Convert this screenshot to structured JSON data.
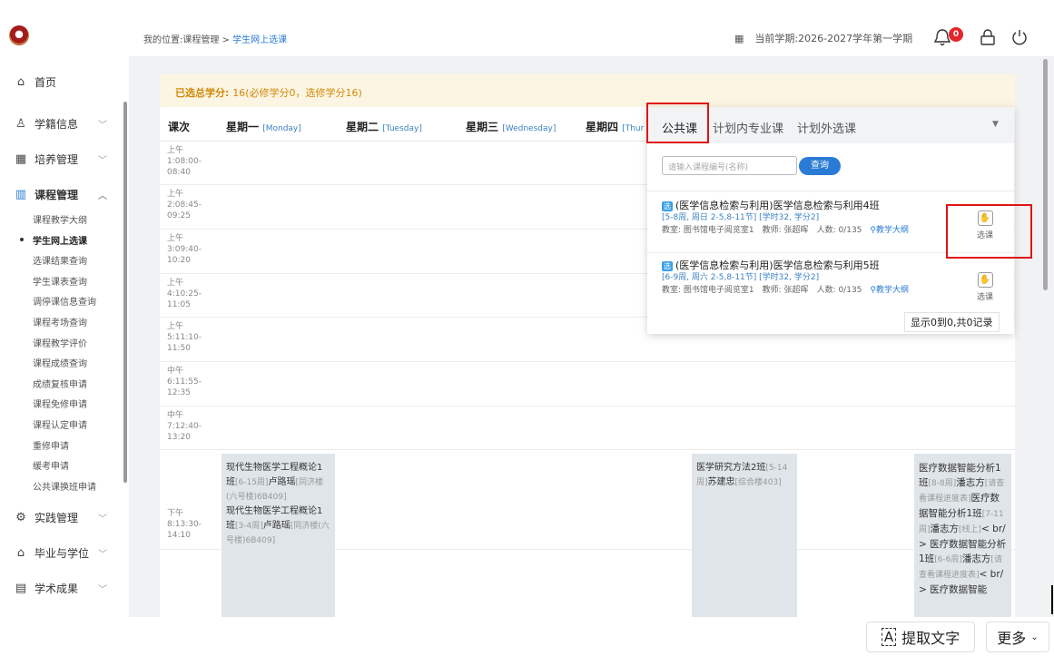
{
  "sidebar": {
    "menu": [
      {
        "label": "首页",
        "icon": "home-icon"
      },
      {
        "label": "学籍信息",
        "icon": "user-icon"
      },
      {
        "label": "培养管理",
        "icon": "chart-icon"
      },
      {
        "label": "课程管理",
        "icon": "books-icon"
      }
    ],
    "submenu": [
      "课程教学大纲",
      "学生网上选课",
      "选课结果查询",
      "学生课表查询",
      "调停课信息查询",
      "课程考场查询",
      "课程教学评价",
      "课程成绩查询",
      "成绩复核申请",
      "课程免修申请",
      "课程认定申请",
      "重修申请",
      "缓考申请",
      "公共课换班申请"
    ],
    "menu_bottom": [
      {
        "label": "实践管理",
        "icon": "settings-icon"
      },
      {
        "label": "毕业与学位",
        "icon": "graduation-icon"
      },
      {
        "label": "学术成果",
        "icon": "document-icon"
      }
    ]
  },
  "header": {
    "breadcrumb_prefix": "我的位置:课程管理 > ",
    "breadcrumb_current": "学生网上选课",
    "semester": "当前学期:2026-2027学年第一学期",
    "notification_count": "0"
  },
  "notice": {
    "label": "已选总学分: ",
    "value": "16(必修学分0，选修学分16)"
  },
  "grid": {
    "col_label": "课次",
    "days": [
      {
        "cn": "星期一",
        "en": "[Monday]"
      },
      {
        "cn": "星期二",
        "en": "[Tuesday]"
      },
      {
        "cn": "星期三",
        "en": "[Wednesday]"
      },
      {
        "cn": "星期四",
        "en": "[Thur"
      }
    ],
    "slots": [
      "上午\n1:08:00-\n08:40",
      "上午\n2:08:45-\n09:25",
      "上午\n3:09:40-\n10:20",
      "上午\n4:10:25-\n11:05",
      "上午\n5:11:10-\n11:50",
      "中午\n6:11:55-\n12:35",
      "中午\n7:12:40-\n13:20",
      "下午\n8:13:30-\n14:10"
    ],
    "cells": {
      "monday": {
        "c1_name": "现代生物医学工程概论1班",
        "c1_detail": "[6-15周]",
        "c1_teacher": "卢路瑶",
        "c1_room": "[同济楼(六号楼)6B409]",
        "c2_name": "现代生物医学工程概论1班",
        "c2_detail": "[3-4周]",
        "c2_teacher": "卢路瑶",
        "c2_room": "[同济楼(六号楼)6B409]"
      },
      "thursday": {
        "name": "医学研究方法2班",
        "detail": "[5-14周]",
        "teacher": "苏建忠",
        "room": "[综合楼403]"
      },
      "sunday": {
        "l1": "医疗数据智能分析1班",
        "l2": "[8-8周]",
        "l3": "潘志方",
        "l4": "[请查看课程进度表]",
        "l5": "医疗数据智能分析1班",
        "l6": "[7-11周]",
        "l7": "潘志方",
        "l8": "[线上]",
        "l9": "< br/ > 医疗数据智能分析1班",
        "l10": "[6-6周]",
        "l11": "潘志方",
        "l12": "[请查看课程进度表]",
        "l13": "< br/ > 医疗数据智能"
      }
    }
  },
  "popup": {
    "tabs": [
      "公共课",
      "计划内专业课",
      "计划外选课"
    ],
    "active_tab": "公共课",
    "search_placeholder": "请输入课程编号(名称)",
    "search_button": "查询",
    "courses": [
      {
        "tag": "选",
        "title": "(医学信息检索与利用)医学信息检索与利用4班",
        "meta": "[5-8周, 周日 2-5,8-11节] [学时32, 学分2]",
        "room": "教室: 图书馆电子阅览室1",
        "teacher": "教师: 张超晖",
        "count": "人数: 0/135",
        "syllabus": "教学大纲",
        "pick": "选课"
      },
      {
        "tag": "选",
        "title": "(医学信息检索与利用)医学信息检索与利用5班",
        "meta": "[6-9周, 周六 2-5,8-11节] [学时32, 学分2]",
        "room": "教室: 图书馆电子阅览室1",
        "teacher": "教师: 张超晖",
        "count": "人数: 0/135",
        "syllabus": "教学大纲",
        "pick": "选课"
      }
    ],
    "pager": "显示0到0,共0记录"
  },
  "toolbar": {
    "ocr_label": "提取文字",
    "more_label": "更多"
  },
  "colors": {
    "accent": "#2a7bd6",
    "highlight": "#e01313",
    "notice_text": "#d08a0a",
    "badge": "#e5252a"
  }
}
